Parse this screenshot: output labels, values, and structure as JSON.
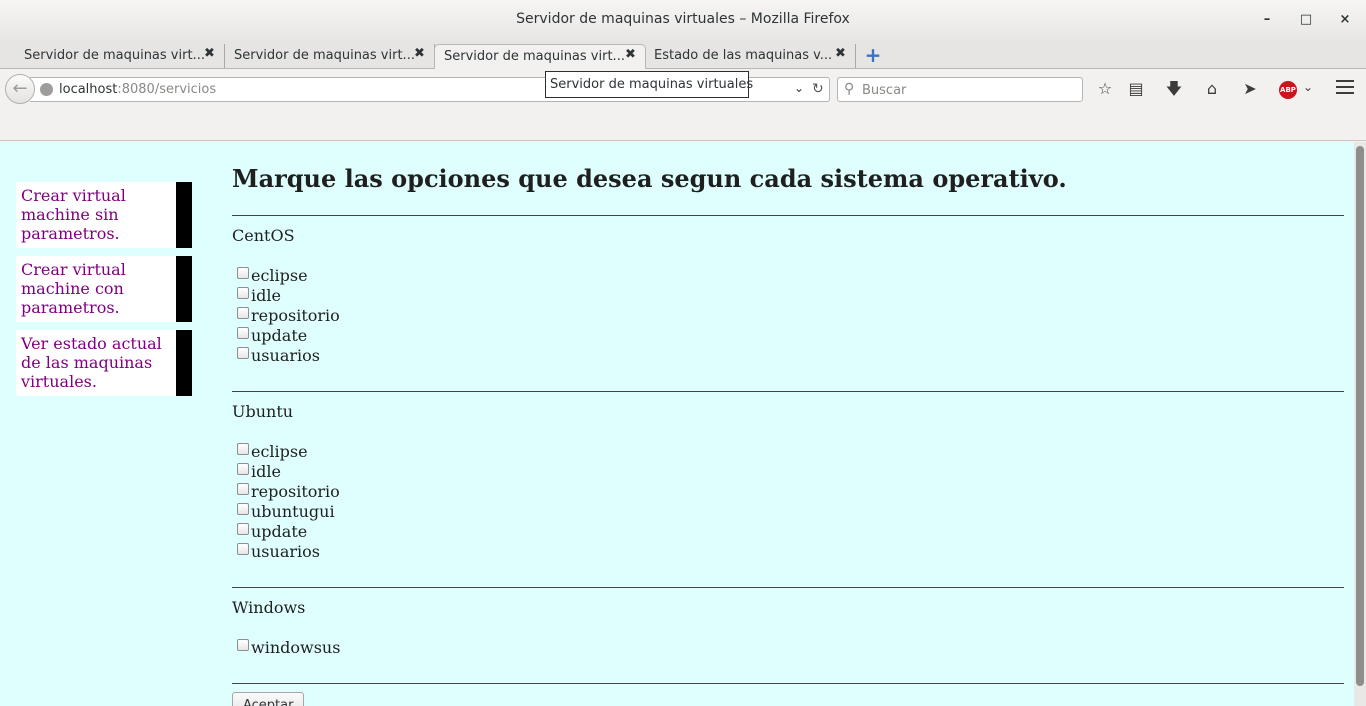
{
  "window": {
    "title": "Servidor de maquinas virtuales – Mozilla Firefox",
    "minimize": "–",
    "maximize": "□",
    "close": "×"
  },
  "tabs": [
    {
      "label": "Servidor de maquinas virt...",
      "active": false
    },
    {
      "label": "Servidor de maquinas virt...",
      "active": false
    },
    {
      "label": "Servidor de maquinas virt...",
      "active": true
    },
    {
      "label": "Estado de las maquinas v...",
      "active": false
    }
  ],
  "tab_close": "✖",
  "new_tab": "+",
  "tooltip": "Servidor de maquinas virtuales",
  "navbar": {
    "url_host": "localhost",
    "url_rest": ":8080/servicios",
    "search_placeholder": "Buscar",
    "icons": [
      "star-icon",
      "reader-icon",
      "download-icon",
      "home-icon",
      "send-icon",
      "adblock-icon",
      "menu-icon"
    ],
    "abp_label": "ABP"
  },
  "sidebar": {
    "items": [
      {
        "label": "Crear virtual machine sin parametros."
      },
      {
        "label": "Crear virtual machine con parametros."
      },
      {
        "label": "Ver estado actual de las maquinas virtuales."
      }
    ]
  },
  "main": {
    "heading": "Marque las opciones que desea segun cada sistema operativo.",
    "sections": [
      {
        "name": "CentOS",
        "options": [
          "eclipse",
          "idle",
          "repositorio",
          "update",
          "usuarios"
        ]
      },
      {
        "name": "Ubuntu",
        "options": [
          "eclipse",
          "idle",
          "repositorio",
          "ubuntugui",
          "update",
          "usuarios"
        ]
      },
      {
        "name": "Windows",
        "options": [
          "windowsus"
        ]
      }
    ],
    "submit_label": "Aceptar"
  },
  "colors": {
    "content_bg": "#dfffff",
    "link": "#800080",
    "sidebar_bar": "#000000"
  }
}
